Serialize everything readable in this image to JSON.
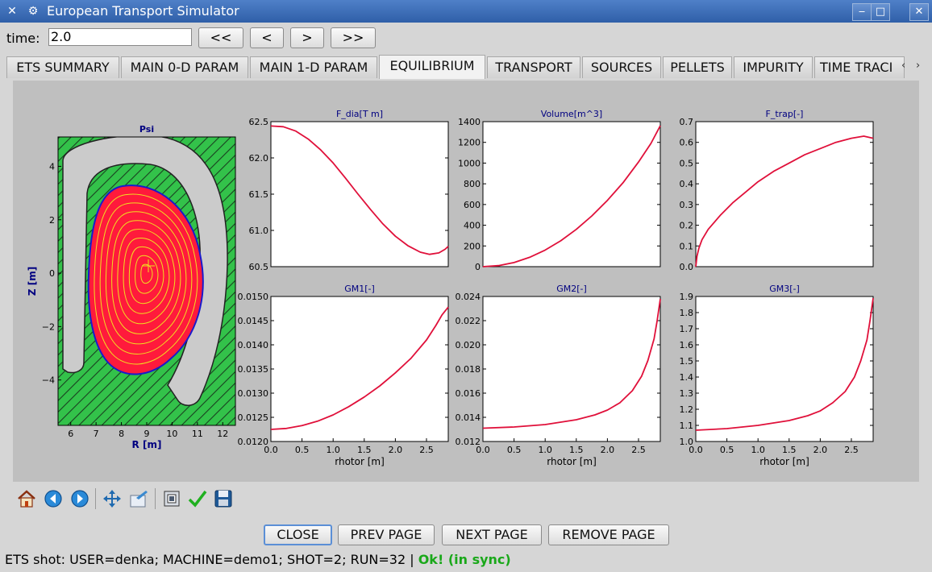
{
  "window": {
    "title": "European Transport Simulator"
  },
  "time": {
    "label": "time:",
    "value": "2.0"
  },
  "nav_buttons": [
    "<<",
    "<",
    ">",
    ">>"
  ],
  "tabs": [
    "ETS SUMMARY",
    "MAIN 0-D PARAM",
    "MAIN 1-D PARAM",
    "EQUILIBRIUM",
    "TRANSPORT",
    "SOURCES",
    "PELLETS",
    "IMPURITY",
    "TIME TRACI"
  ],
  "active_tab": "EQUILIBRIUM",
  "colors": {
    "plot_line": "#e0103a",
    "plasma_fill": "#ff1a3c",
    "wall_fill": "#33c24a",
    "contour": "#f0e020",
    "separatrix": "#1a1acc"
  },
  "toolbar_icons": [
    "home-icon",
    "back-icon",
    "forward-icon",
    "pan-icon",
    "configure-subplots-icon",
    "save-figure-icon",
    "check-icon",
    "floppy-disk-icon"
  ],
  "bottom_buttons": [
    "CLOSE",
    "PREV PAGE",
    "NEXT PAGE",
    "REMOVE PAGE"
  ],
  "status": {
    "text": "ETS shot: USER=denka; MACHINE=demo1; SHOT=2; RUN=32 |",
    "sync": "Ok! (in sync)"
  },
  "chart_data": [
    {
      "type": "contour",
      "title": "Psi",
      "xlabel": "R [m]",
      "ylabel": "Z [m]",
      "xlim": [
        5.5,
        12.5
      ],
      "ylim": [
        -5.7,
        5.1
      ],
      "xticks": [
        "6",
        "7",
        "8",
        "9",
        "10",
        "11",
        "12"
      ],
      "yticks": [
        "4",
        "2",
        "0",
        "−2",
        "−4"
      ],
      "axis_center": [
        9.0,
        0.0
      ]
    },
    {
      "type": "line",
      "title": "F_dia[T m]",
      "xlabel": "",
      "ylabel": "",
      "xlim": [
        0,
        2.85
      ],
      "ylim": [
        60.5,
        62.5
      ],
      "xticks": [],
      "yticks": [
        "62.5",
        "62.0",
        "61.5",
        "61.0",
        "60.5"
      ],
      "x": [
        0,
        0.2,
        0.4,
        0.6,
        0.8,
        1.0,
        1.2,
        1.4,
        1.6,
        1.8,
        2.0,
        2.2,
        2.4,
        2.55,
        2.7,
        2.8,
        2.85
      ],
      "y": [
        62.44,
        62.43,
        62.37,
        62.26,
        62.11,
        61.93,
        61.72,
        61.5,
        61.29,
        61.09,
        60.92,
        60.79,
        60.7,
        60.67,
        60.69,
        60.74,
        60.78
      ]
    },
    {
      "type": "line",
      "title": "Volume[m^3]",
      "xlabel": "",
      "ylabel": "",
      "xlim": [
        0,
        2.85
      ],
      "ylim": [
        0,
        1400
      ],
      "xticks": [],
      "yticks": [
        "1400",
        "1200",
        "1000",
        "800",
        "600",
        "400",
        "200",
        "0"
      ],
      "x": [
        0,
        0.25,
        0.5,
        0.75,
        1.0,
        1.25,
        1.5,
        1.75,
        2.0,
        2.25,
        2.5,
        2.7,
        2.85
      ],
      "y": [
        0,
        10,
        40,
        90,
        160,
        250,
        360,
        490,
        640,
        810,
        1010,
        1190,
        1360
      ]
    },
    {
      "type": "line",
      "title": "F_trap[-]",
      "xlabel": "",
      "ylabel": "",
      "xlim": [
        0,
        2.85
      ],
      "ylim": [
        0,
        0.7
      ],
      "xticks": [],
      "yticks": [
        "0.7",
        "0.6",
        "0.5",
        "0.4",
        "0.3",
        "0.2",
        "0.1",
        "0.0"
      ],
      "x": [
        0,
        0.02,
        0.05,
        0.1,
        0.2,
        0.4,
        0.6,
        0.8,
        1.0,
        1.25,
        1.5,
        1.75,
        2.0,
        2.25,
        2.5,
        2.7,
        2.85
      ],
      "y": [
        0.0,
        0.05,
        0.09,
        0.13,
        0.18,
        0.25,
        0.31,
        0.36,
        0.41,
        0.46,
        0.5,
        0.54,
        0.57,
        0.6,
        0.62,
        0.63,
        0.62
      ]
    },
    {
      "type": "line",
      "title": "GM1[-]",
      "xlabel": "rhotor [m]",
      "ylabel": "",
      "xlim": [
        0,
        2.85
      ],
      "ylim": [
        0.012,
        0.015
      ],
      "xticks": [
        "0.0",
        "0.5",
        "1.0",
        "1.5",
        "2.0",
        "2.5"
      ],
      "yticks": [
        "0.0150",
        "0.0145",
        "0.0140",
        "0.0135",
        "0.0130",
        "0.0125",
        "0.0120"
      ],
      "x": [
        0,
        0.25,
        0.5,
        0.75,
        1.0,
        1.25,
        1.5,
        1.75,
        2.0,
        2.25,
        2.5,
        2.65,
        2.75,
        2.85
      ],
      "y": [
        0.01225,
        0.01227,
        0.01233,
        0.01242,
        0.01255,
        0.01272,
        0.01292,
        0.01315,
        0.01342,
        0.01372,
        0.0141,
        0.0144,
        0.01462,
        0.01478
      ]
    },
    {
      "type": "line",
      "title": "GM2[-]",
      "xlabel": "rhotor [m]",
      "ylabel": "",
      "xlim": [
        0,
        2.85
      ],
      "ylim": [
        0.012,
        0.024
      ],
      "xticks": [
        "0.0",
        "0.5",
        "1.0",
        "1.5",
        "2.0",
        "2.5"
      ],
      "yticks": [
        "0.024",
        "0.022",
        "0.020",
        "0.018",
        "0.016",
        "0.014",
        "0.012"
      ],
      "x": [
        0,
        0.5,
        1.0,
        1.5,
        1.8,
        2.0,
        2.2,
        2.4,
        2.55,
        2.65,
        2.75,
        2.8,
        2.85
      ],
      "y": [
        0.0131,
        0.0132,
        0.0134,
        0.0138,
        0.0142,
        0.0146,
        0.0152,
        0.0162,
        0.0174,
        0.0187,
        0.0205,
        0.022,
        0.0238
      ]
    },
    {
      "type": "line",
      "title": "GM3[-]",
      "xlabel": "rhotor [m]",
      "ylabel": "",
      "xlim": [
        0,
        2.85
      ],
      "ylim": [
        1.0,
        1.9
      ],
      "xticks": [
        "0.0",
        "0.5",
        "1.0",
        "1.5",
        "2.0",
        "2.5"
      ],
      "yticks": [
        "1.9",
        "1.8",
        "1.7",
        "1.6",
        "1.5",
        "1.4",
        "1.3",
        "1.2",
        "1.1",
        "1.0"
      ],
      "x": [
        0,
        0.5,
        1.0,
        1.5,
        1.8,
        2.0,
        2.2,
        2.4,
        2.55,
        2.65,
        2.75,
        2.8,
        2.85
      ],
      "y": [
        1.07,
        1.08,
        1.1,
        1.13,
        1.16,
        1.19,
        1.24,
        1.31,
        1.4,
        1.5,
        1.63,
        1.75,
        1.89
      ]
    }
  ]
}
